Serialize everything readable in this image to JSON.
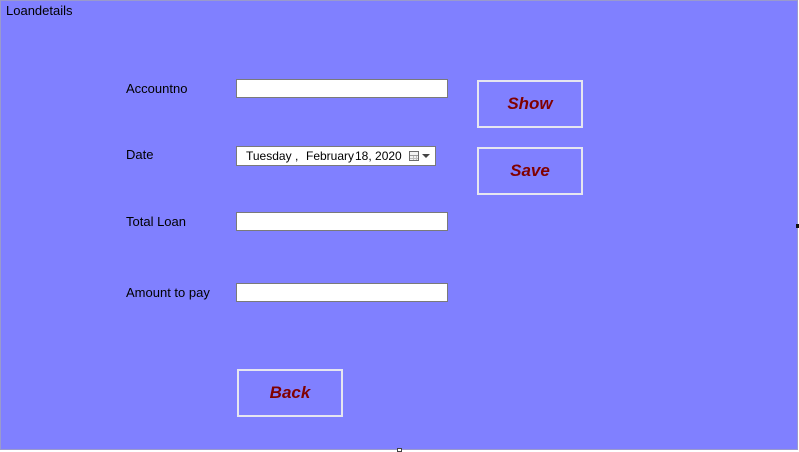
{
  "window": {
    "title": "Loandetails"
  },
  "fields": {
    "accountno": {
      "label": "Accountno",
      "value": ""
    },
    "date": {
      "label": "Date",
      "weekday": "Tuesday",
      "sep": ",",
      "month": "February",
      "day_year": "18, 2020"
    },
    "total_loan": {
      "label": "Total Loan",
      "value": ""
    },
    "amount_to_pay": {
      "label": "Amount to pay",
      "value": ""
    }
  },
  "buttons": {
    "show": "Show",
    "save": "Save",
    "back": "Back"
  },
  "colors": {
    "background": "#8080ff",
    "button_text": "#800000",
    "button_border": "#e6e6f0"
  },
  "icons": {
    "date_dropdown": "calendar-icon"
  }
}
